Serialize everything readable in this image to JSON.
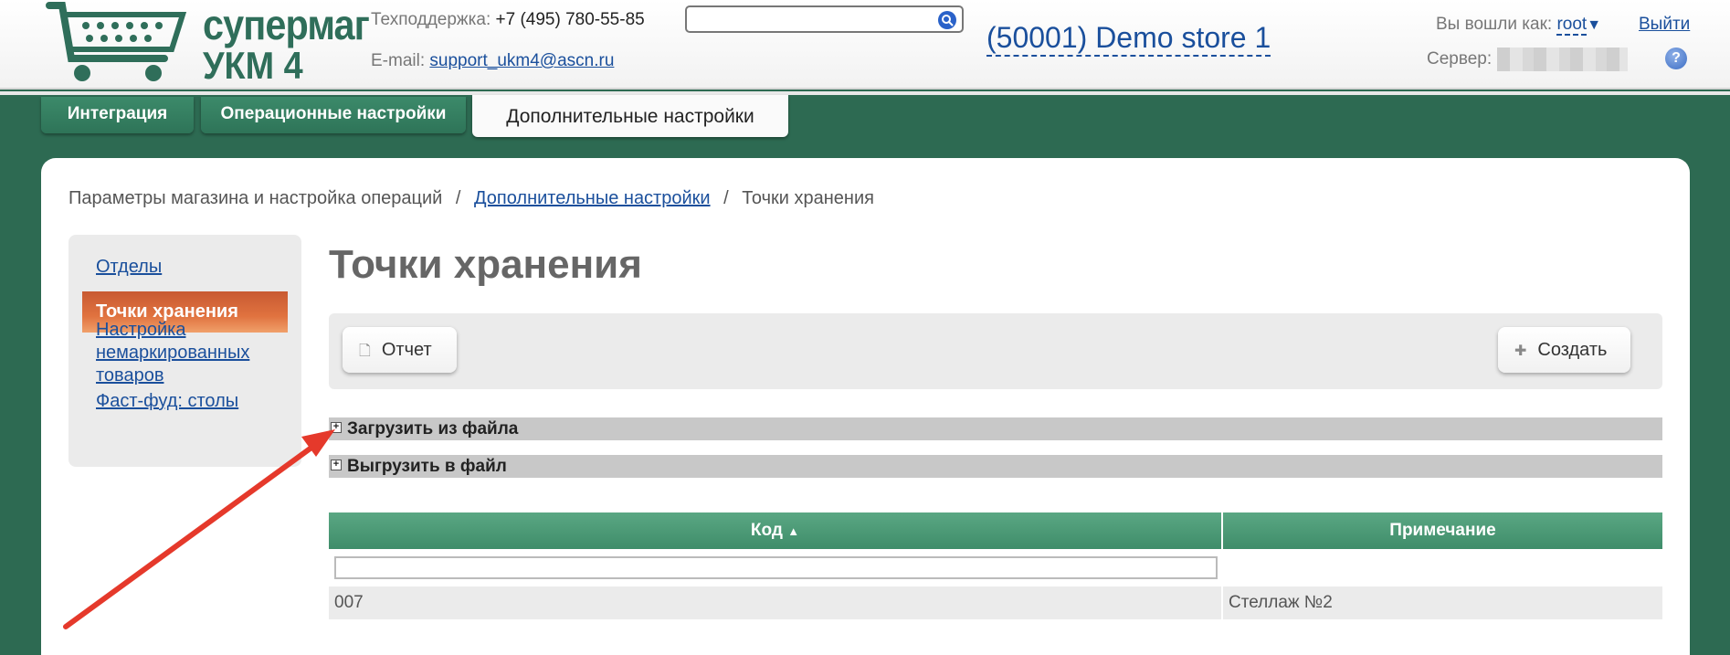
{
  "header": {
    "logo": {
      "line1": "супермаг",
      "line2": "УКМ 4"
    },
    "support_label": "Техподдержка:",
    "support_phone": "+7 (495) 780-55-85",
    "email_label": "E-mail:",
    "email": "support_ukm4@ascn.ru",
    "search": {
      "value": "",
      "placeholder": ""
    },
    "store_name": "(50001) Demo store 1",
    "logged_in_label": "Вы вошли как:",
    "user": "root",
    "logout_label": "Выйти",
    "server_label": "Сервер:",
    "help_label": "?"
  },
  "tabs": [
    {
      "label": "Интеграция"
    },
    {
      "label": "Операционные настройки"
    },
    {
      "label": "Дополнительные настройки"
    }
  ],
  "breadcrumb": {
    "root": "Параметры магазина и настройка операций",
    "middle": "Дополнительные настройки",
    "current": "Точки хранения",
    "sep": "/"
  },
  "sidebar": {
    "items": [
      {
        "label": "Отделы"
      },
      {
        "label": "Точки хранения"
      },
      {
        "label_lines": [
          "Настройка",
          "немаркированных",
          "товаров"
        ]
      },
      {
        "label": "Фаст-фуд: столы"
      }
    ]
  },
  "main": {
    "title": "Точки хранения",
    "report_button": "Отчет",
    "create_button": "Создать",
    "upload_section": "Загрузить из файла",
    "download_section": "Выгрузить в файл"
  },
  "table": {
    "columns": [
      {
        "label": "Код",
        "sort": "▲"
      },
      {
        "label": "Примечание"
      }
    ],
    "filter_value": "",
    "rows": [
      {
        "code": "007",
        "note": "Стеллаж №2"
      }
    ]
  },
  "colors": {
    "background": "#2d6a52",
    "brand_green": "#2f6e5a",
    "link": "#1a4f9c",
    "active_side": "#e0723f",
    "annotation_arrow": "#e5392b"
  }
}
